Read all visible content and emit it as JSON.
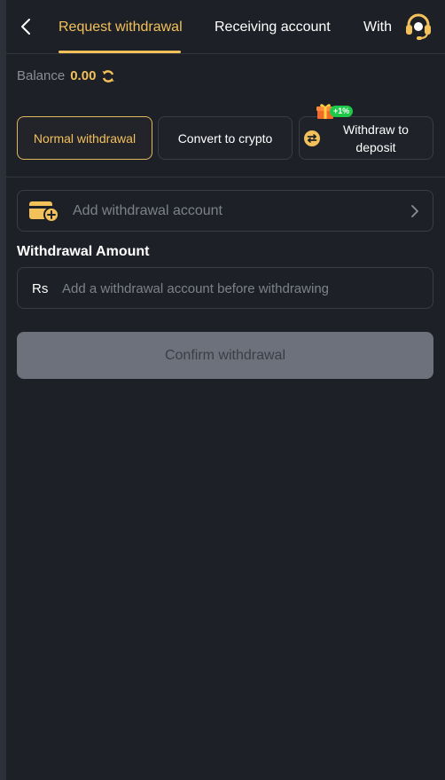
{
  "header": {
    "tabs": [
      {
        "label": "Request withdrawal",
        "active": true
      },
      {
        "label": "Receiving account",
        "active": false
      },
      {
        "label": "With",
        "active": false
      }
    ],
    "back_icon": "chevron-left-icon",
    "support_icon": "headset-icon"
  },
  "balance": {
    "label": "Balance",
    "value": "0.00",
    "refresh_icon": "refresh-icon"
  },
  "methods": [
    {
      "label": "Normal withdrawal",
      "selected": true
    },
    {
      "label": "Convert to crypto",
      "selected": false
    },
    {
      "label": "Withdraw to deposit",
      "selected": false,
      "badge": "+1%"
    }
  ],
  "add_account": {
    "label": "Add withdrawal account"
  },
  "amount": {
    "title": "Withdrawal Amount",
    "currency": "Rs",
    "placeholder": "Add a withdrawal account before withdrawing",
    "value": ""
  },
  "confirm": {
    "label": "Confirm withdrawal"
  },
  "colors": {
    "accent": "#f2c15a",
    "background": "#1e2027",
    "border": "#3a3d46",
    "button_disabled": "#6c717b",
    "badge_green": "#1ec94a"
  }
}
